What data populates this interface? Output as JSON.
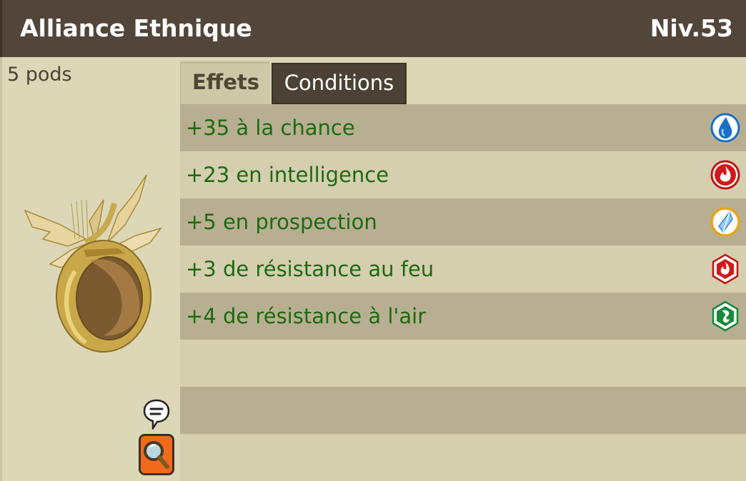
{
  "header": {
    "title": "Alliance Ethnique",
    "level": "Niv.53"
  },
  "item": {
    "weight": "5 pods",
    "image": "ring-icon"
  },
  "actions": {
    "chat_icon": "speech-bubble-icon",
    "search_icon": "magnifier-icon"
  },
  "tabs": [
    {
      "label": "Effets",
      "active": true
    },
    {
      "label": "Conditions",
      "active": false
    }
  ],
  "effects": [
    {
      "text": "+35 à la chance",
      "icon": "water-drop-icon",
      "color": "#1a6fc9"
    },
    {
      "text": "+23 en intelligence",
      "icon": "fire-icon",
      "color": "#d11a1a"
    },
    {
      "text": "+5 en prospection",
      "icon": "crystal-icon",
      "color": "#e8a415"
    },
    {
      "text": "+3 de résistance au feu",
      "icon": "fire-resistance-icon",
      "color": "#d11a1a"
    },
    {
      "text": "+4 de résistance à l'air",
      "icon": "air-resistance-icon",
      "color": "#168a3a"
    }
  ],
  "colors": {
    "header": "#514639",
    "effect_text": "#1d6a12",
    "row_dark": "#b8af92",
    "row_light": "#d5ceaf"
  }
}
